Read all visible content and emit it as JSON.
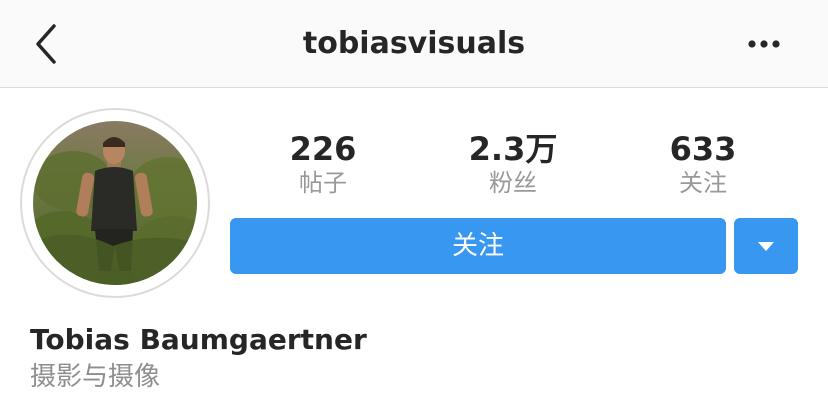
{
  "header": {
    "title": "tobiasvisuals",
    "back_icon": "chevron-left-icon",
    "more_icon": "more-horizontal-icon"
  },
  "profile": {
    "avatar_icon": "profile-photo",
    "stats": [
      {
        "value": "226",
        "label": "帖子"
      },
      {
        "value": "2.3万",
        "label": "粉丝"
      },
      {
        "value": "633",
        "label": "关注"
      }
    ],
    "follow_label": "关注",
    "dropdown_icon": "caret-down-icon",
    "full_name": "Tobias Baumgaertner",
    "bio": "摄影与摄像"
  },
  "colors": {
    "accent": "#3897f0",
    "text_primary": "#262626",
    "text_secondary": "#999999",
    "nav_background": "#fafafa",
    "border": "#dbdbdb"
  }
}
